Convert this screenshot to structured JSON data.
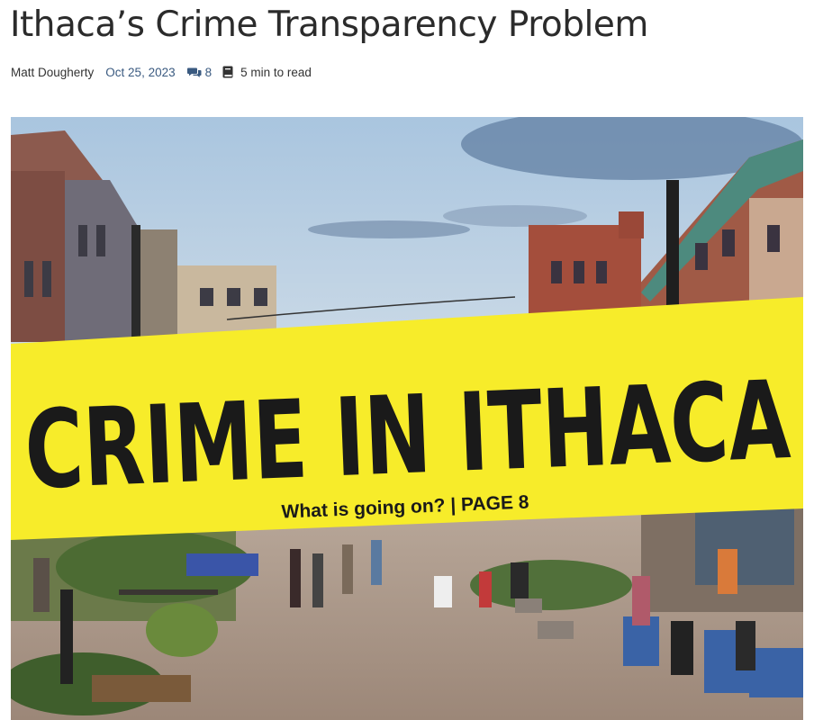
{
  "article": {
    "title": "Ithaca’s Crime Transparency Problem",
    "author": "Matt Dougherty",
    "date": "Oct 25, 2023",
    "comment_count": "8",
    "read_time": "5 min to read"
  },
  "hero": {
    "banner_headline": "CRIME IN ITHACA",
    "banner_subline": "What is going on? | PAGE 8",
    "tape_color": "#f7ec2a"
  },
  "icons": {
    "comments": "comments-icon",
    "read_time": "book-icon"
  },
  "colors": {
    "link": "#3a5a80",
    "title": "#2b2b2b"
  }
}
